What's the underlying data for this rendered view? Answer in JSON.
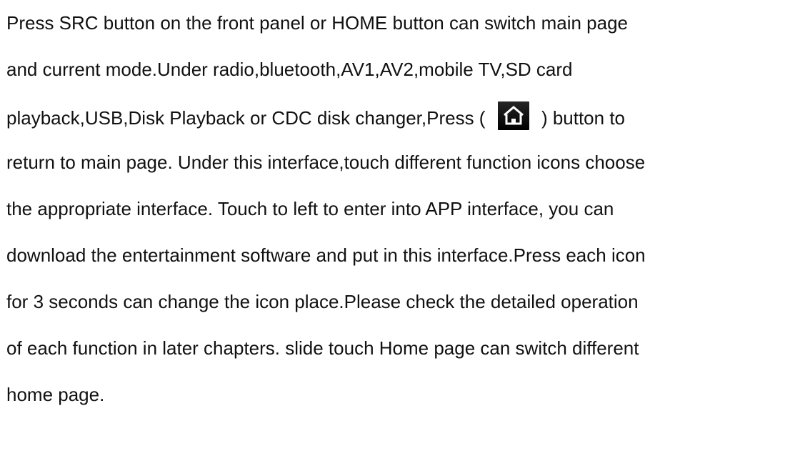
{
  "paragraph": {
    "line1": "Press SRC button on the front panel or HOME button can switch main page",
    "line2": "and current mode.Under radio,bluetooth,AV1,AV2,mobile TV,SD card",
    "line3_before_icon": "playback,USB,Disk Playback or CDC disk changer,Press (",
    "line3_after_icon": ") button to",
    "line4": "return to main page. Under this interface,touch different function icons choose",
    "line5": "the appropriate interface. Touch to left to enter into APP interface, you can",
    "line6": "download the entertainment software and put in this interface.Press each icon",
    "line7": "for 3 seconds can change the icon place.Please check the detailed operation",
    "line8": "of each function in later chapters. slide touch Home page can switch different",
    "line9": "home page."
  },
  "icons": {
    "home_button_icon": "home-icon"
  }
}
